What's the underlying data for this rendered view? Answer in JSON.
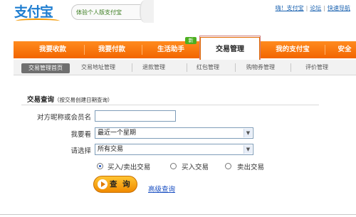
{
  "header": {
    "logo": "支付宝",
    "slogan": "体验个人版支付宝",
    "links": [
      "嗨！支付宝",
      "论坛",
      "快速导航"
    ]
  },
  "main_nav": {
    "items": [
      "我要收款",
      "我要付款",
      "生活助手",
      "交易管理",
      "我的支付宝",
      "安全"
    ],
    "active": "交易管理",
    "new_badge": "新"
  },
  "sub_nav": {
    "items": [
      "交易管理首页",
      "交易地址管理",
      "退款管理",
      "红包管理",
      "购物券管理",
      "评价管理"
    ],
    "active": "交易管理首页"
  },
  "section": {
    "title": "交易查询",
    "hint": "（按交易创建日期查询）"
  },
  "form": {
    "nickname_label": "对方昵称或会员名",
    "nickname_value": "",
    "period_label": "我要看",
    "period_value": "最近一个星期",
    "type_label": "请选择",
    "type_value": "所有交易",
    "radio_options": [
      "买入/卖出交易",
      "买入交易",
      "卖出交易"
    ],
    "radio_selected": 0,
    "query_button": "查 询",
    "advanced_link": "高级查询"
  },
  "colors": {
    "accent": "#ff6c00",
    "link": "#1a62b0"
  }
}
